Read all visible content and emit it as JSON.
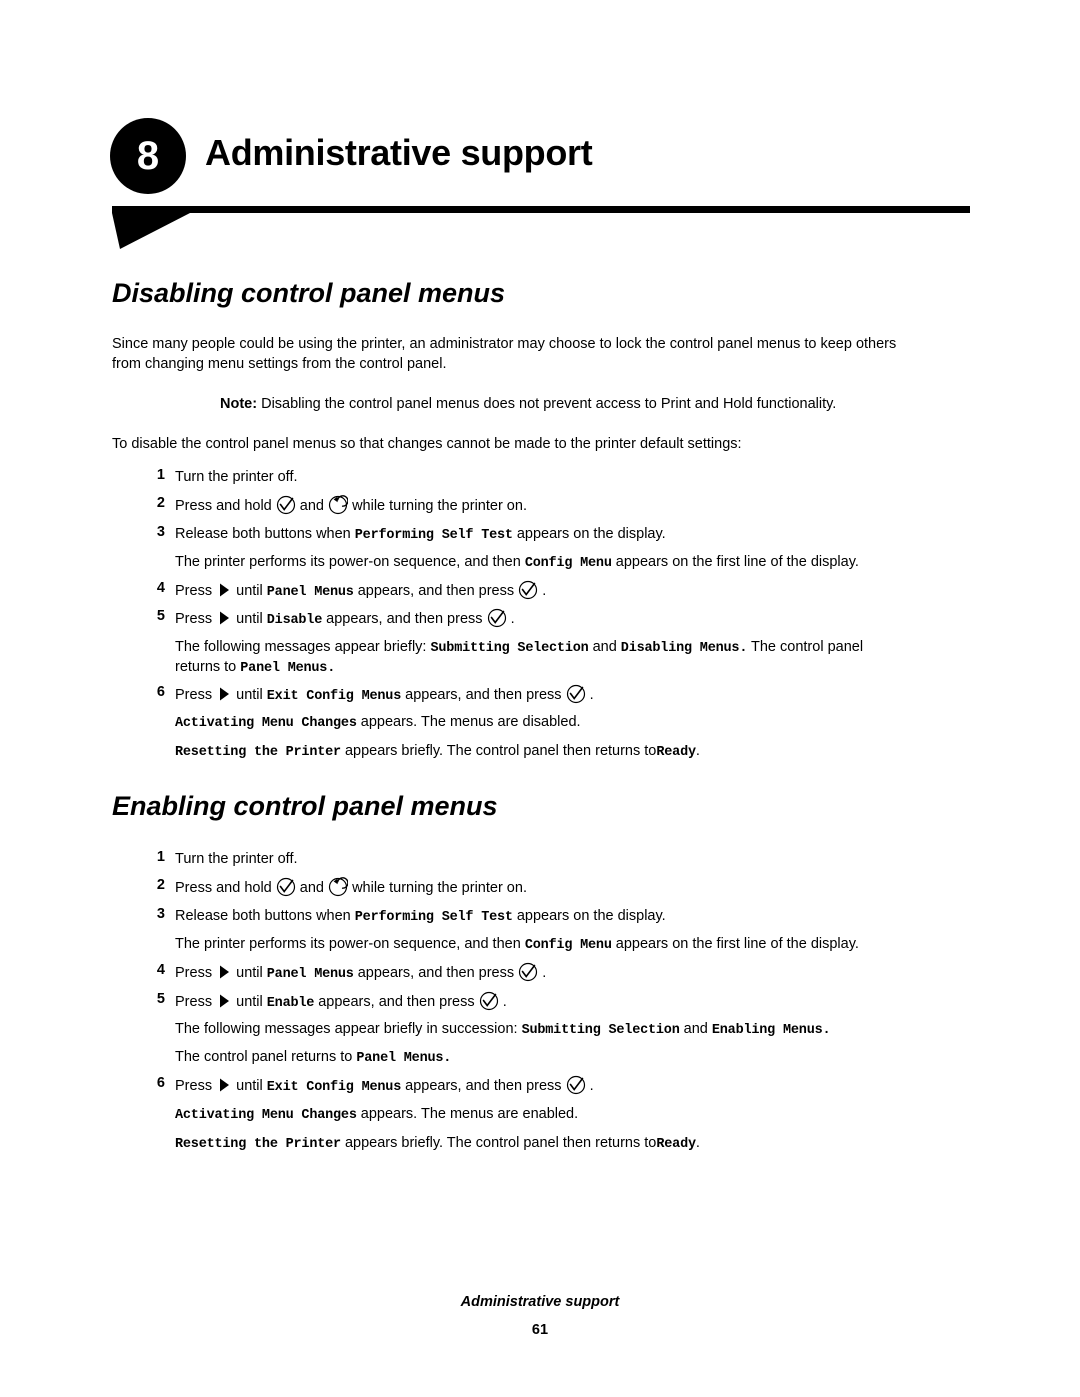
{
  "chapter": {
    "number": "8",
    "title": "Administrative support"
  },
  "sections": {
    "disabling": {
      "heading": "Disabling control panel menus",
      "intro_line1": "Since many people could be using the printer, an administrator may choose to lock the control panel menus to keep others",
      "intro_line2": "from changing menu settings from the control panel.",
      "note_label": "Note:",
      "note_text": "Disabling the control panel menus does not prevent access to Print and Hold functionality.",
      "lead_in": "To disable the control panel menus so that changes cannot be made to the printer default settings:",
      "steps": [
        {
          "num": "1",
          "text": "Turn the printer off."
        },
        {
          "num": "2",
          "text_a": "Press and hold",
          "text_b": "and",
          "text_c": "while turning the printer on."
        },
        {
          "num": "3",
          "text_a": "Release both buttons when",
          "mono_a": "Performing Self Test",
          "text_b": "appears on the display."
        },
        {
          "num": "4",
          "text_a": "Press",
          "text_b": "until",
          "mono_a": "Panel Menus",
          "text_c": "appears, and then press",
          "text_d": "."
        },
        {
          "num": "5",
          "text_a": "Press",
          "text_b": "until",
          "mono_a": "Disable",
          "text_c": "appears, and then press",
          "text_d": "."
        },
        {
          "num": "6",
          "text_a": "Press",
          "text_b": "until",
          "mono_a": "Exit Config Menus",
          "text_c": "appears, and then press",
          "text_d": "."
        }
      ],
      "note_after_3_a": "The printer performs its power-on sequence, and then",
      "note_after_3_mono": "Config Menu",
      "note_after_3_b": "appears on the first line of the display.",
      "note_after_5_line1_a": "The following messages appear briefly:",
      "note_after_5_line1_mono1": "Submitting Selection",
      "note_after_5_line1_b": "and",
      "note_after_5_line1_mono2": "Disabling Menus.",
      "note_after_5_line1_c": "The control panel",
      "note_after_5_line2_a": "returns to",
      "note_after_5_line2_mono": "Panel Menus.",
      "note_after_6_line1_mono": "Activating Menu Changes",
      "note_after_6_line1_text": "appears. The menus are disabled.",
      "note_after_6_line2_mono": "Resetting the Printer",
      "note_after_6_line2_text": "appears briefly. The control panel then returns to",
      "note_after_6_line2_mono2": "Ready",
      "note_after_6_line2_end": "."
    },
    "enabling": {
      "heading": "Enabling control panel menus",
      "steps": [
        {
          "num": "1",
          "text": "Turn the printer off."
        },
        {
          "num": "2",
          "text_a": "Press and hold",
          "text_b": "and",
          "text_c": "while turning the printer on."
        },
        {
          "num": "3",
          "text_a": "Release both buttons when",
          "mono_a": "Performing Self Test",
          "text_b": "appears on the display."
        },
        {
          "num": "4",
          "text_a": "Press",
          "text_b": "until",
          "mono_a": "Panel Menus",
          "text_c": "appears, and then press",
          "text_d": "."
        },
        {
          "num": "5",
          "text_a": "Press",
          "text_b": "until",
          "mono_a": "Enable",
          "text_c": "appears, and then press",
          "text_d": "."
        },
        {
          "num": "6",
          "text_a": "Press",
          "text_b": "until",
          "mono_a": "Exit Config Menus",
          "text_c": "appears, and then press",
          "text_d": "."
        }
      ],
      "note_after_3_a": "The printer performs its power-on sequence, and then",
      "note_after_3_mono": "Config Menu",
      "note_after_3_b": "appears on the first line of the display.",
      "note_after_5_line1_a": "The following messages appear briefly in succession:",
      "note_after_5_line1_mono1": "Submitting Selection",
      "note_after_5_line1_b": "and",
      "note_after_5_line1_mono2": "Enabling Menus.",
      "note_after_5_line2_a": "The control panel returns to",
      "note_after_5_line2_mono": "Panel Menus.",
      "note_after_6_line1_mono": "Activating Menu Changes",
      "note_after_6_line1_text": "appears. The menus are enabled.",
      "note_after_6_line2_mono": "Resetting the Printer",
      "note_after_6_line2_text": "appears briefly. The control panel then returns to",
      "note_after_6_line2_mono2": "Ready",
      "note_after_6_line2_end": "."
    }
  },
  "footer": {
    "title": "Administrative support",
    "page": "61"
  },
  "icons": {
    "select": "select-checkmark-button-icon",
    "return": "return-arrow-button-icon",
    "navigate": "right-arrow-button-icon"
  }
}
